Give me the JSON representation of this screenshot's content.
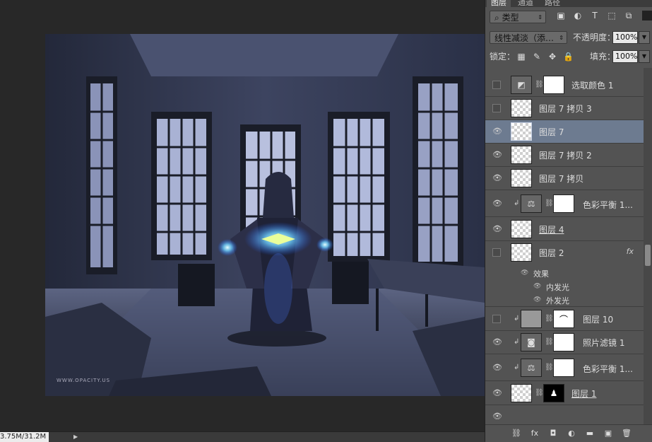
{
  "status": {
    "doc_size": "3.75M/31.2M"
  },
  "canvas": {
    "watermark": "WWW.OPACITY.US"
  },
  "panel": {
    "tabs": [
      "图层",
      "通道",
      "路径"
    ],
    "filter": {
      "kind_label": "类型"
    },
    "blend_mode": "线性减淡（添…",
    "opacity_label": "不透明度：",
    "opacity_value": "100%",
    "lock_label": "锁定：",
    "fill_label": "填充：",
    "fill_value": "100%"
  },
  "layers": [
    {
      "name": "选取颜色 1",
      "visible": false,
      "type": "adjustment",
      "icon": "selective-color-icon"
    },
    {
      "name": "图层 7 拷贝 3",
      "visible": false,
      "type": "pixel"
    },
    {
      "name": "图层 7",
      "visible": true,
      "type": "pixel",
      "selected": true
    },
    {
      "name": "图层 7 拷贝 2",
      "visible": true,
      "type": "pixel"
    },
    {
      "name": "图层 7 拷贝",
      "visible": true,
      "type": "pixel"
    },
    {
      "name": "色彩平衡 1...",
      "visible": true,
      "type": "adjustment",
      "icon": "balance-icon",
      "clipped": true
    },
    {
      "name": "图层 4",
      "visible": true,
      "type": "pixel",
      "underline": true
    },
    {
      "name": "图层 2",
      "visible": false,
      "type": "pixel",
      "fx": "fx"
    },
    {
      "name": "图层 10",
      "visible": false,
      "type": "masked",
      "clipped": true
    },
    {
      "name": "照片滤镜 1",
      "visible": true,
      "type": "adjustment",
      "icon": "camera-icon",
      "clipped": true
    },
    {
      "name": "色彩平衡 1...",
      "visible": true,
      "type": "adjustment",
      "icon": "balance-icon",
      "clipped": true
    },
    {
      "name": "图层 1",
      "visible": true,
      "type": "masked-black",
      "underline": true
    }
  ],
  "effects": {
    "title": "效果",
    "items": [
      "内发光",
      "外发光"
    ]
  }
}
